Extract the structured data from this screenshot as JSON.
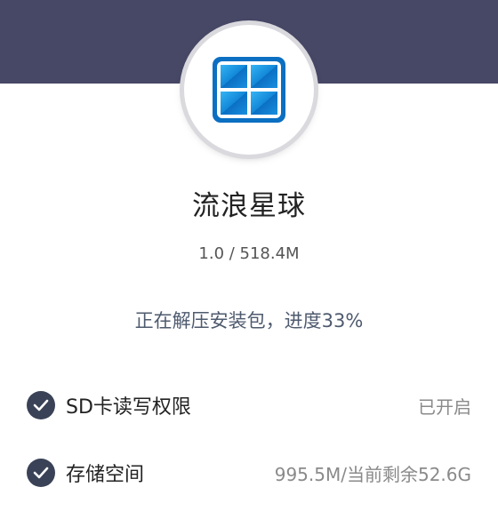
{
  "app": {
    "name": "流浪星球",
    "version_size": "1.0 / 518.4M",
    "icon": "windows-logo-icon"
  },
  "install": {
    "status_text": "正在解压安装包，进度33%",
    "progress_percent": 33
  },
  "permissions": [
    {
      "label": "SD卡读写权限",
      "value": "已开启",
      "icon": "check-circle-icon"
    },
    {
      "label": "存储空间",
      "value": "995.5M/当前剩余52.6G",
      "icon": "check-circle-icon"
    }
  ],
  "colors": {
    "banner": "#474766",
    "check_bg": "#3a4257",
    "status_text": "#4e5a6e",
    "icon_blue": "#1a8fd8"
  }
}
